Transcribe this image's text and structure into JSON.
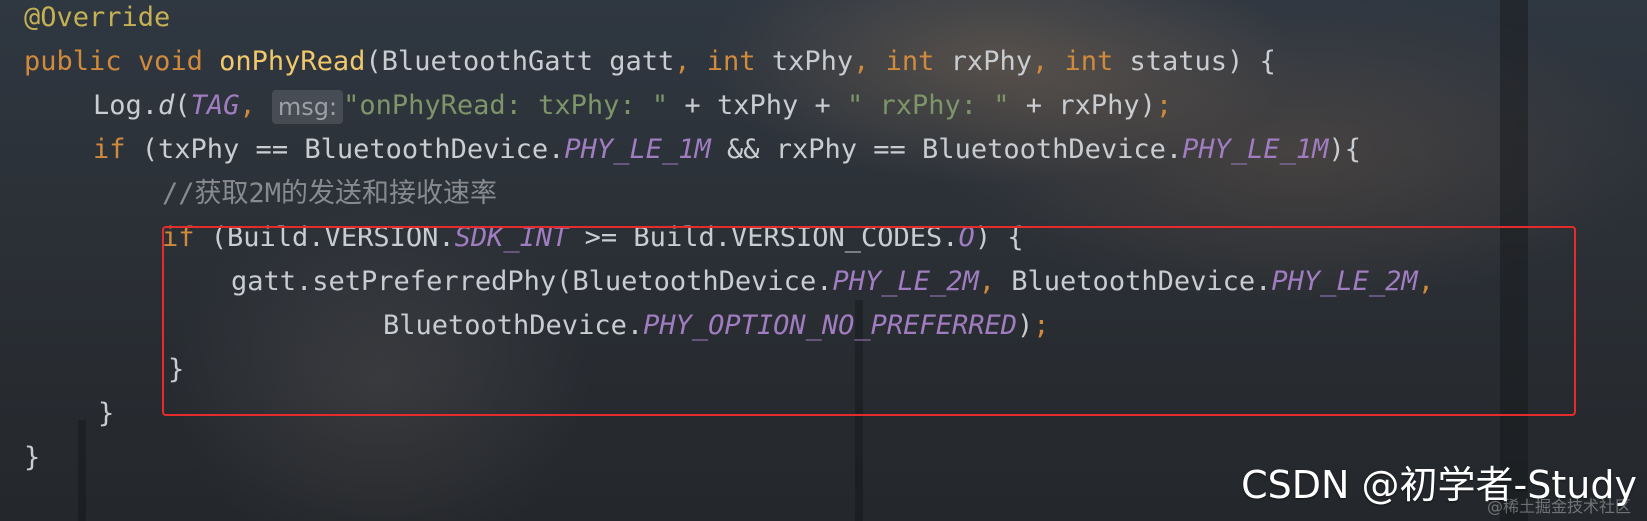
{
  "code": {
    "l1": {
      "annotation": "@Override"
    },
    "l2": {
      "kw1": "public",
      "kw2": "void",
      "fn": "onPhyRead",
      "p1": "(BluetoothGatt gatt",
      "c1": ", ",
      "kw3": "int",
      "p2": " txPhy",
      "c2": ", ",
      "kw4": "int",
      "p3": " rxPhy",
      "c3": ", ",
      "kw5": "int",
      "p4": " status) {"
    },
    "l3": {
      "t1": "Log.",
      "method": "d",
      "t2": "(",
      "tag": "TAG",
      "c1": ", ",
      "hint": "msg:",
      "str1": "\"onPhyRead: txPhy: \"",
      "t3": " + txPhy + ",
      "str2": "\" rxPhy: \"",
      "t4": " + rxPhy)",
      "semi": ";"
    },
    "l4": {
      "kw": "if",
      "t1": " (txPhy == BluetoothDevice.",
      "c1": "PHY_LE_1M",
      "t2": " && rxPhy == BluetoothDevice.",
      "c2": "PHY_LE_1M",
      "t3": "){"
    },
    "l5": {
      "comment": "//获取2M的发送和接收速率"
    },
    "l6": {
      "kw": "if",
      "t1": " (Build.VERSION.",
      "c1": "SDK_INT",
      "t2": " >= Build.VERSION_CODES.",
      "c2": "O",
      "t3": ") {"
    },
    "l7": {
      "t1": "gatt.setPreferredPhy(BluetoothDevice.",
      "c1": "PHY_LE_2M",
      "comma1": ", ",
      "t2": "BluetoothDevice.",
      "c2": "PHY_LE_2M",
      "comma2": ","
    },
    "l8": {
      "t1": "BluetoothDevice.",
      "c1": "PHY_OPTION_NO_PREFERRED",
      "t2": ")",
      "semi": ";"
    },
    "l9": {
      "t": "}"
    },
    "l10": {
      "t": "}"
    },
    "l11": {
      "t": "}"
    }
  },
  "watermark": {
    "main": "CSDN @初学者-Study",
    "sub": "@稀土掘金技术社区"
  },
  "colors": {
    "keyword": "#d08a3c",
    "annotation": "#c4b154",
    "function": "#f1c86a",
    "string": "#7d9569",
    "constant": "#a07cc0",
    "comment": "#878b8f",
    "highlight": "#e52b2b"
  }
}
